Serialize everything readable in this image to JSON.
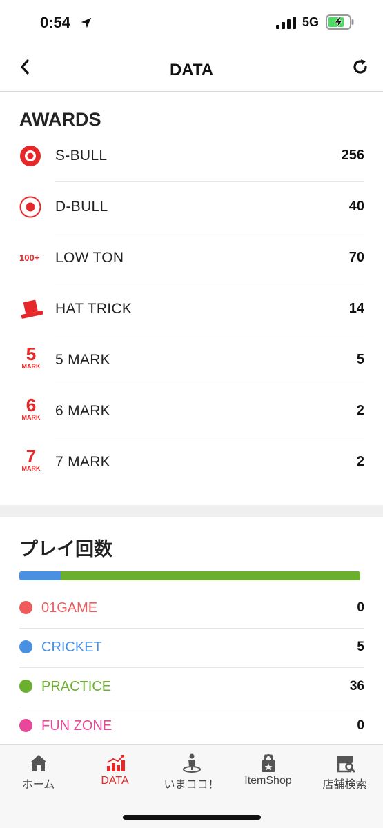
{
  "status_bar": {
    "time": "0:54",
    "network": "5G"
  },
  "header": {
    "title": "DATA"
  },
  "awards": {
    "title": "AWARDS",
    "items": [
      {
        "icon": "s-bull-icon",
        "label": "S-BULL",
        "value": "256"
      },
      {
        "icon": "d-bull-icon",
        "label": "D-BULL",
        "value": "40"
      },
      {
        "icon": "low-ton-icon",
        "icon_text": "100+",
        "label": "LOW TON",
        "value": "70"
      },
      {
        "icon": "hat-trick-icon",
        "label": "HAT TRICK",
        "value": "14"
      },
      {
        "icon": "five-mark-icon",
        "icon_number": "5",
        "icon_text": "MARK",
        "label": "5 MARK",
        "value": "5"
      },
      {
        "icon": "six-mark-icon",
        "icon_number": "6",
        "icon_text": "MARK",
        "label": "6 MARK",
        "value": "2"
      },
      {
        "icon": "seven-mark-icon",
        "icon_number": "7",
        "icon_text": "MARK",
        "label": "7 MARK",
        "value": "2"
      }
    ]
  },
  "play_count": {
    "title": "プレイ回数",
    "items": [
      {
        "label": "01GAME",
        "value": "0",
        "color": "#ef5b5b"
      },
      {
        "label": "CRICKET",
        "value": "5",
        "color": "#4a90e2"
      },
      {
        "label": "PRACTICE",
        "value": "36",
        "color": "#6ab02e"
      },
      {
        "label": "FUN ZONE",
        "value": "0",
        "color": "#e8479a"
      }
    ]
  },
  "tabs": [
    {
      "label": "ホーム",
      "icon": "home-icon",
      "active": false
    },
    {
      "label": "DATA",
      "icon": "chart-icon",
      "active": true
    },
    {
      "label": "いまココ！",
      "icon": "location-person-icon",
      "active": false
    },
    {
      "label": "ItemShop",
      "icon": "shop-bag-icon",
      "active": false
    },
    {
      "label": "店舗検索",
      "icon": "store-search-icon",
      "active": false
    }
  ],
  "colors": {
    "accent": "#e5282a",
    "divider": "#e6e6e6"
  }
}
